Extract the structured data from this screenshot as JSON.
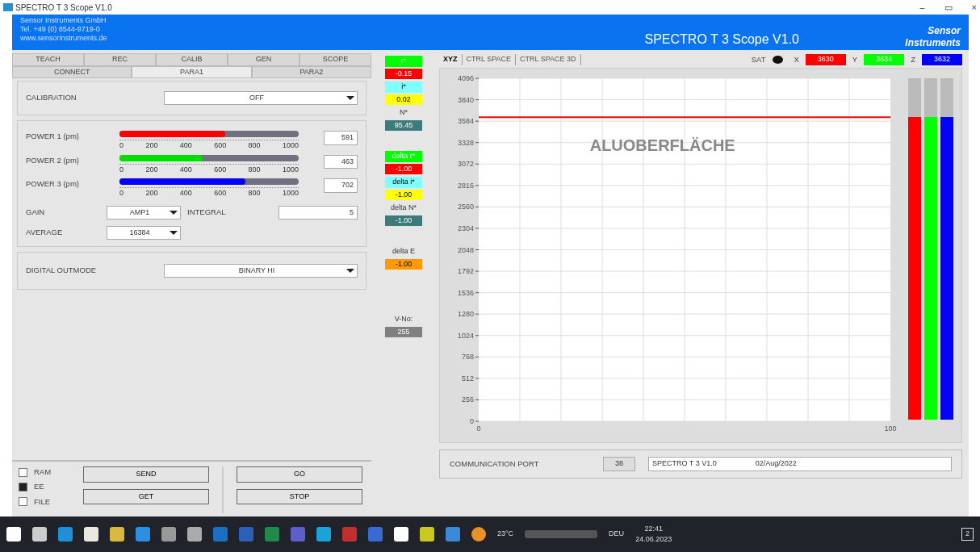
{
  "window": {
    "title": "SPECTRO T 3 Scope V1.0",
    "controls": [
      "–",
      "▭",
      "×"
    ]
  },
  "header": {
    "company": [
      "Sensor Instruments GmbH",
      "Tel. +49 (0) 8544-9719-0",
      "www.sensorinstruments.de"
    ],
    "app_title": "SPECTRO T 3 Scope V1.0",
    "logo": [
      "Sensor",
      "Instruments"
    ]
  },
  "tabs_top": [
    {
      "label": "TEACH",
      "selected": false
    },
    {
      "label": "REC",
      "selected": false
    },
    {
      "label": "CALIB",
      "selected": false
    },
    {
      "label": "GEN",
      "selected": false
    },
    {
      "label": "SCOPE",
      "selected": false
    }
  ],
  "tabs_bottom": [
    {
      "label": "CONNECT",
      "selected": false
    },
    {
      "label": "PARA1",
      "selected": true
    },
    {
      "label": "PARA2",
      "selected": false
    }
  ],
  "calibration": {
    "label": "CALIBRATION",
    "value": "OFF"
  },
  "powers": [
    {
      "label": "POWER 1 (pm)",
      "color": "#ff0000",
      "level": 0.591,
      "value": "591",
      "ticks": [
        "0",
        "200",
        "400",
        "600",
        "800",
        "1000"
      ]
    },
    {
      "label": "POWER 2 (pm)",
      "color": "#00e000",
      "level": 0.463,
      "value": "463",
      "ticks": [
        "0",
        "200",
        "400",
        "600",
        "800",
        "1000"
      ]
    },
    {
      "label": "POWER 3 (pm)",
      "color": "#0000ff",
      "level": 0.702,
      "value": "702",
      "ticks": [
        "0",
        "200",
        "400",
        "600",
        "800",
        "1000"
      ]
    }
  ],
  "gain": {
    "label": "GAIN",
    "value": "AMP1"
  },
  "integral": {
    "label": "INTEGRAL",
    "value": "5"
  },
  "average": {
    "label": "AVERAGE",
    "value": "16384"
  },
  "digital_outmode": {
    "label": "DIGITAL OUTMODE",
    "value": "BINARY HI"
  },
  "memory": [
    {
      "label": "RAM",
      "checked": false
    },
    {
      "label": "EE",
      "checked": true
    },
    {
      "label": "FILE",
      "checked": false
    }
  ],
  "buttons_left": [
    "SEND",
    "GET"
  ],
  "buttons_right": [
    "GO",
    "STOP"
  ],
  "readouts": [
    {
      "label": {
        "text": "r*",
        "color": "#00ff00"
      },
      "value": {
        "text": "-0.15",
        "color": "#ff0000"
      }
    },
    {
      "label": {
        "text": "i*",
        "color": "#80ffff"
      },
      "value": {
        "text": "0.02",
        "color": "#ffff00"
      }
    },
    {
      "label": {
        "text": "N*"
      },
      "value": {
        "text": "95.45",
        "color": "#3d7a7a"
      }
    },
    {
      "label": {
        "text": "delta r*",
        "color": "#00ff00"
      },
      "value": {
        "text": "-1.00",
        "color": "#ff0000"
      }
    },
    {
      "label": {
        "text": "delta i*",
        "color": "#80ffff"
      },
      "value": {
        "text": "-1.00",
        "color": "#ffff00"
      }
    },
    {
      "label": {
        "text": "delta N*"
      },
      "value": {
        "text": "-1.00",
        "color": "#3d7a7a"
      }
    },
    {
      "label": {
        "text": "delta E"
      },
      "value": {
        "text": "-1.00",
        "color": "#ff9900"
      }
    },
    {
      "label": {
        "text": "V-No:"
      },
      "value": {
        "text": "255",
        "color": "#808080"
      }
    }
  ],
  "chart_tabs": [
    {
      "label": "XYZ",
      "selected": true
    },
    {
      "label": "CTRL SPACE",
      "selected": false
    },
    {
      "label": "CTRL SPACE 3D",
      "selected": false
    }
  ],
  "sat": {
    "label": "SAT"
  },
  "xyz": [
    {
      "label": "X",
      "value": "3630",
      "color": "#ff0000"
    },
    {
      "label": "Y",
      "value": "3634",
      "color": "#00ff00"
    },
    {
      "label": "Z",
      "value": "3632",
      "color": "#0000ff"
    }
  ],
  "chart": {
    "annotation": "ALUOBERFLÄCHE",
    "chart_data": {
      "type": "line",
      "x": [
        0,
        100
      ],
      "series": [
        {
          "color": "#ff0000",
          "values": [
            3630,
            3630
          ]
        }
      ],
      "xlim": [
        0,
        100
      ],
      "ylim": [
        0,
        4096
      ],
      "xticks": [
        0,
        100
      ],
      "yticks": [
        0,
        256,
        512,
        768,
        1024,
        1280,
        1536,
        1792,
        2048,
        2304,
        2560,
        2816,
        3072,
        3328,
        3584,
        3840,
        4096
      ],
      "grid": true
    }
  },
  "meters": [
    {
      "color": "#ff0000",
      "level": 0.886
    },
    {
      "color": "#00ff00",
      "level": 0.887
    },
    {
      "color": "#0000ff",
      "level": 0.887
    }
  ],
  "comm": {
    "label": "COMMUNICATION PORT",
    "port": "38",
    "info": "SPECTRO T 3 V1.0",
    "date": "02/Aug/2022"
  },
  "taskbar": {
    "weather": "23°C",
    "language": "DEU",
    "time": "22:41",
    "date": "24.06.2023",
    "notifications": "2"
  }
}
